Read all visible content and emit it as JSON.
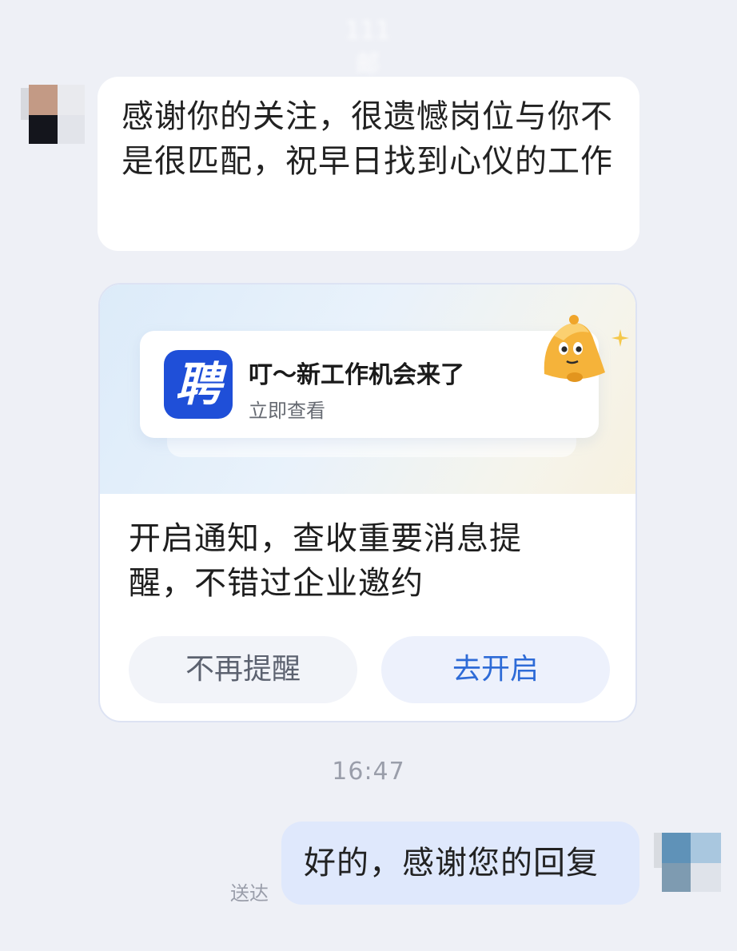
{
  "header": {
    "contact_name_obscured": "111 邮"
  },
  "messages": {
    "incoming_text": "感谢你的关注，很遗憾岗位与你不是很匹配，祝早日找到心仪的工作",
    "outgoing_text": "好的，感谢您的回复",
    "outgoing_status": "送达",
    "timestamp": "16:47"
  },
  "notification_card": {
    "app_logo_glyph": "聘",
    "preview_title": "叮～新工作机会来了",
    "preview_subtitle": "立即查看",
    "description": "开启通知，查收重要消息提醒，不错过企业邀约",
    "dismiss_button": "不再提醒",
    "enable_button": "去开启",
    "icons": {
      "bell": "bell-mascot-icon",
      "sparkle": "sparkle-icon"
    }
  },
  "colors": {
    "background": "#eef0f6",
    "incoming_bubble": "#ffffff",
    "outgoing_bubble": "#dfe8fc",
    "accent": "#2e6bd7",
    "app_logo": "#1f4fd8",
    "bell": "#f5b33a"
  }
}
